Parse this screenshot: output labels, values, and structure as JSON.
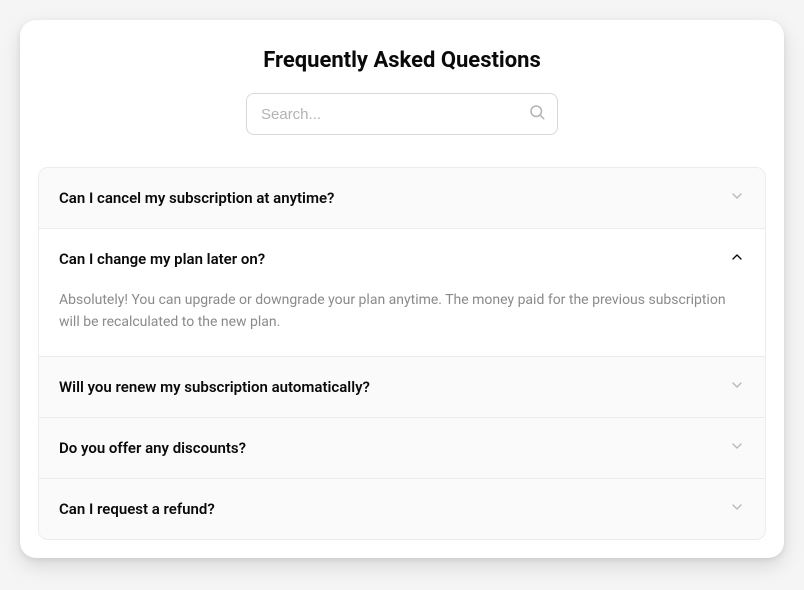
{
  "title": "Frequently Asked Questions",
  "search": {
    "placeholder": "Search...",
    "value": ""
  },
  "faq": [
    {
      "question": "Can I cancel my subscription at anytime?",
      "answer": "",
      "expanded": false
    },
    {
      "question": "Can I change my plan later on?",
      "answer": "Absolutely! You can upgrade or downgrade your plan anytime. The money paid for the previous subscription will be recalculated to the new plan.",
      "expanded": true
    },
    {
      "question": "Will you renew my subscription automatically?",
      "answer": "",
      "expanded": false
    },
    {
      "question": "Do you offer any discounts?",
      "answer": "",
      "expanded": false
    },
    {
      "question": "Can I request a refund?",
      "answer": "",
      "expanded": false
    }
  ]
}
